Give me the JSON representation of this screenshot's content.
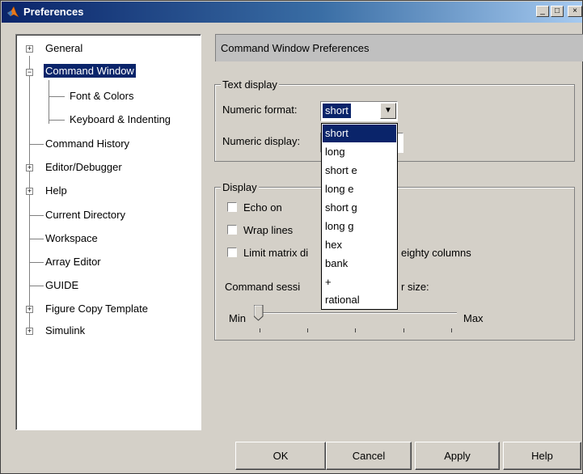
{
  "window": {
    "title": "Preferences",
    "controls": {
      "minimize": "_",
      "maximize": "□",
      "close": "×"
    }
  },
  "tree": {
    "items": [
      {
        "label": "General",
        "expander": "+"
      },
      {
        "label": "Command Window",
        "expander": "−",
        "selected": true
      },
      {
        "label": "Font & Colors"
      },
      {
        "label": "Keyboard & Indenting"
      },
      {
        "label": "Command History"
      },
      {
        "label": "Editor/Debugger",
        "expander": "+"
      },
      {
        "label": "Help",
        "expander": "+"
      },
      {
        "label": "Current Directory"
      },
      {
        "label": "Workspace"
      },
      {
        "label": "Array Editor"
      },
      {
        "label": "GUIDE"
      },
      {
        "label": "Figure Copy Template",
        "expander": "+"
      },
      {
        "label": "Simulink",
        "expander": "+"
      }
    ]
  },
  "panel": {
    "header": "Command Window Preferences",
    "text_display": {
      "title": "Text display",
      "numeric_format_label": "Numeric format:",
      "numeric_format_value": "short",
      "numeric_display_label": "Numeric display:"
    },
    "display": {
      "title": "Display",
      "echo_on": "Echo on",
      "wrap_lines": "Wrap lines",
      "limit_matrix_prefix": "Limit matrix di",
      "limit_matrix_suffix": "eighty columns",
      "buffer_prefix": "Command sessi",
      "buffer_suffix": "r size:",
      "slider_min": "Min",
      "slider_max": "Max"
    },
    "dropdown_options": [
      "short",
      "long",
      "short e",
      "long e",
      "short g",
      "long g",
      "hex",
      "bank",
      "+",
      "rational"
    ],
    "dropdown_selected": "short"
  },
  "buttons": {
    "ok": "OK",
    "cancel": "Cancel",
    "apply": "Apply",
    "help": "Help"
  },
  "colors": {
    "selection": "#0a246a",
    "dialog_bg": "#d4d0c8",
    "title_start": "#0a246a",
    "title_end": "#a6caf0"
  },
  "icons": {
    "app": "matlab-logo-icon",
    "expand": "plus-box-icon",
    "collapse": "minus-box-icon",
    "combo_arrow": "triangle-down-icon"
  }
}
